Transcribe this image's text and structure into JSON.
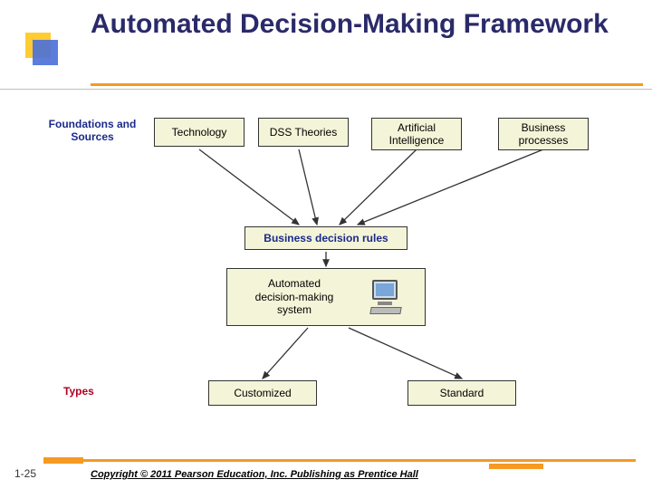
{
  "title": "Automated Decision-Making Framework",
  "labels": {
    "foundations": "Foundations and Sources",
    "types": "Types"
  },
  "top_boxes": {
    "technology": "Technology",
    "dss": "DSS Theories",
    "ai": "Artificial Intelligence",
    "bp": "Business processes"
  },
  "mid": {
    "rules": "Business decision rules",
    "system_l1": "Automated",
    "system_l2": "decision-making",
    "system_l3": "system"
  },
  "bottom_boxes": {
    "customized": "Customized",
    "standard": "Standard"
  },
  "icons": {
    "pc": "computer-icon"
  },
  "footer": {
    "page": "1-25",
    "copyright": "Copyright © 2011 Pearson Education, Inc. Publishing as Prentice Hall"
  }
}
